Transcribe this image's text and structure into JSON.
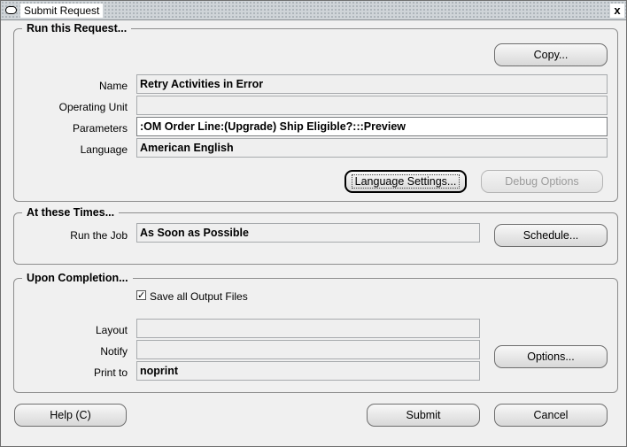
{
  "window": {
    "title": "Submit Request",
    "close_glyph": "x"
  },
  "run_request": {
    "legend": "Run this Request...",
    "copy_button": "Copy...",
    "name_label": "Name",
    "name_value": "Retry Activities in Error",
    "operating_unit_label": "Operating Unit",
    "operating_unit_value": "",
    "parameters_label": "Parameters",
    "parameters_value": ":OM Order Line:(Upgrade) Ship Eligible?:::Preview",
    "language_label": "Language",
    "language_value": "American English",
    "language_settings_button": "Language Settings...",
    "debug_options_button": "Debug Options"
  },
  "times": {
    "legend": "At these Times...",
    "run_job_label": "Run the Job",
    "run_job_value": "As Soon as Possible",
    "schedule_button": "Schedule..."
  },
  "completion": {
    "legend": "Upon Completion...",
    "save_output_checked": true,
    "save_output_label": "Save all Output Files",
    "layout_label": "Layout",
    "layout_value": "",
    "notify_label": "Notify",
    "notify_value": "",
    "print_to_label": "Print to",
    "print_to_value": "noprint",
    "options_button": "Options..."
  },
  "footer": {
    "help_button": "Help (C)",
    "submit_button": "Submit",
    "cancel_button": "Cancel"
  },
  "colors": {
    "panel": "#f0f0f0",
    "field_readonly": "#efefef",
    "field_editable": "#ffffff"
  }
}
